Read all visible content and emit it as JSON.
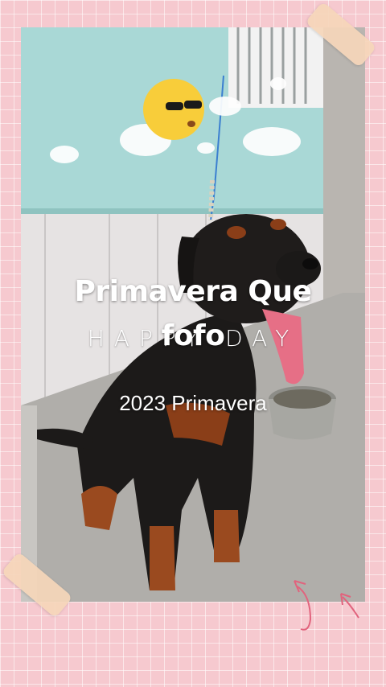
{
  "story": {
    "title_line1": "Primavera Que",
    "title_line2": "fofo",
    "sticker_text": "HAPPY DAY",
    "subtitle": "2023 Primavera"
  },
  "stickers": {
    "sun": "sun-with-sunglasses-icon",
    "cloud": "cloud-icon",
    "arrows": "pink-doodle-arrows-icon",
    "tape": "masking-tape-icon"
  },
  "colors": {
    "background": "#f6c9cf",
    "wall": "#a9d8d6",
    "text": "#ffffff"
  }
}
